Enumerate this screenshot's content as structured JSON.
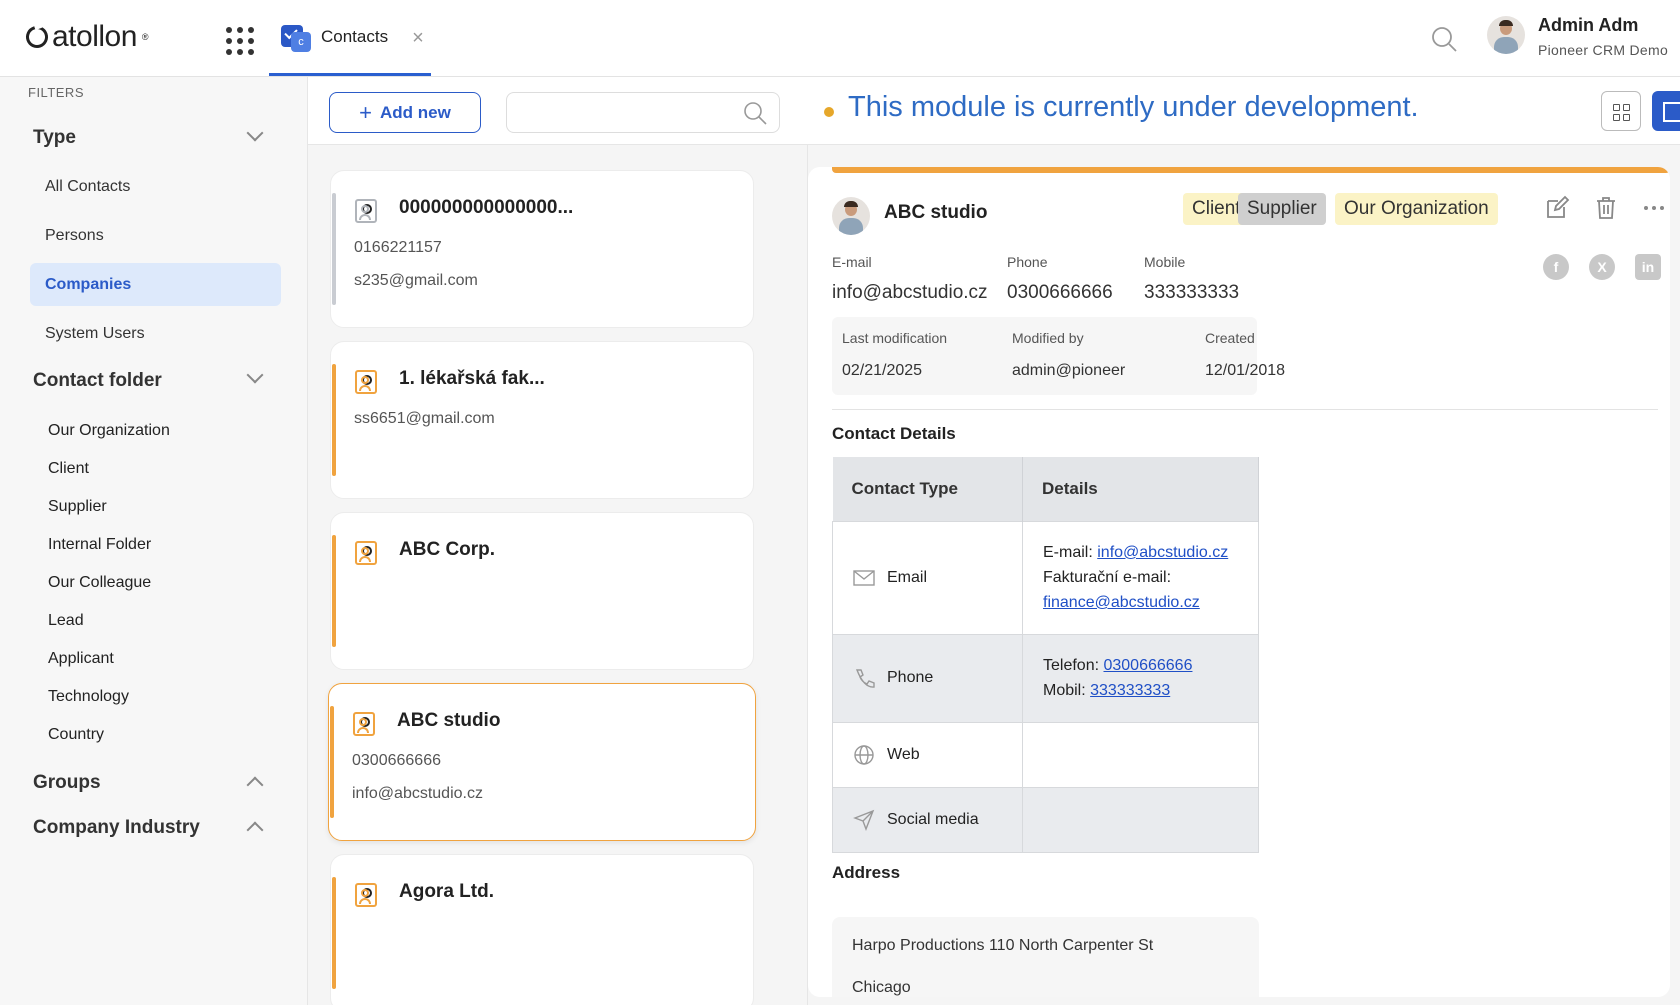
{
  "app": {
    "logo_text": "atollon",
    "tab_label": "Contacts",
    "tab_close": "×",
    "user_name": "Admin Adm",
    "user_subtitle": "Pioneer CRM Demo"
  },
  "sidebar": {
    "filters_label": "FILTERS",
    "type_heading": "Type",
    "type_items": [
      {
        "label": "All Contacts",
        "active": false
      },
      {
        "label": "Persons",
        "active": false
      },
      {
        "label": "Companies",
        "active": true
      },
      {
        "label": "System Users",
        "active": false
      }
    ],
    "folder_heading": "Contact folder",
    "folder_items": [
      "Our Organization",
      "Client",
      "Supplier",
      "Internal Folder",
      "Our Colleague",
      "Lead",
      "Applicant",
      "Technology",
      "Country"
    ],
    "groups_heading": "Groups",
    "industry_heading": "Company Industry"
  },
  "list": {
    "add_label": "Add new",
    "search_placeholder": "",
    "cards": [
      {
        "title": "000000000000000...",
        "line1": "0166221157",
        "line2": "s235@gmail.com",
        "accent": "gray",
        "selected": false
      },
      {
        "title": "1. lékařská fak...",
        "line1": "ss6651@gmail.com",
        "line2": "",
        "accent": "orange",
        "selected": false
      },
      {
        "title": "ABC Corp.",
        "line1": "",
        "line2": "",
        "accent": "orange",
        "selected": false
      },
      {
        "title": "ABC studio",
        "line1": "0300666666",
        "line2": "info@abcstudio.cz",
        "accent": "orange",
        "selected": true
      },
      {
        "title": "Agora Ltd.",
        "line1": "",
        "line2": "",
        "accent": "orange",
        "selected": false
      }
    ]
  },
  "detail": {
    "dev_message": "This module is currently under development.",
    "name": "ABC studio",
    "badges": {
      "client": "Client",
      "supplier": "Supplier",
      "org": "Our Organization"
    },
    "email_label": "E-mail",
    "email_value": "info@abcstudio.cz",
    "phone_label": "Phone",
    "phone_value": "0300666666",
    "mobile_label": "Mobile",
    "mobile_value": "333333333",
    "last_mod_label": "Last modification",
    "last_mod_value": "02/21/2025",
    "modified_by_label": "Modified by",
    "modified_by_value": "admin@pioneer",
    "created_label": "Created",
    "created_value": "12/01/2018",
    "contact_details_title": "Contact Details",
    "table": {
      "col_type": "Contact Type",
      "col_details": "Details",
      "email_type": "Email",
      "email_prefix": "E-mail: ",
      "email_link": "info@abcstudio.cz",
      "finance_prefix": "Fakturační e-mail:",
      "finance_link": "finance@abcstudio.cz",
      "phone_type": "Phone",
      "tel_prefix": "Telefon: ",
      "tel_link": "0300666666",
      "mob_prefix": "Mobil: ",
      "mob_link": "333333333",
      "web_type": "Web",
      "social_type": "Social media"
    },
    "address_title": "Address",
    "address_line1": "Harpo Productions 110 North Carpenter St",
    "address_line2": "Chicago"
  },
  "colors": {
    "accent_blue": "#2b5bc8",
    "accent_orange": "#f0a33f",
    "dev_text": "#2e6bc4"
  }
}
